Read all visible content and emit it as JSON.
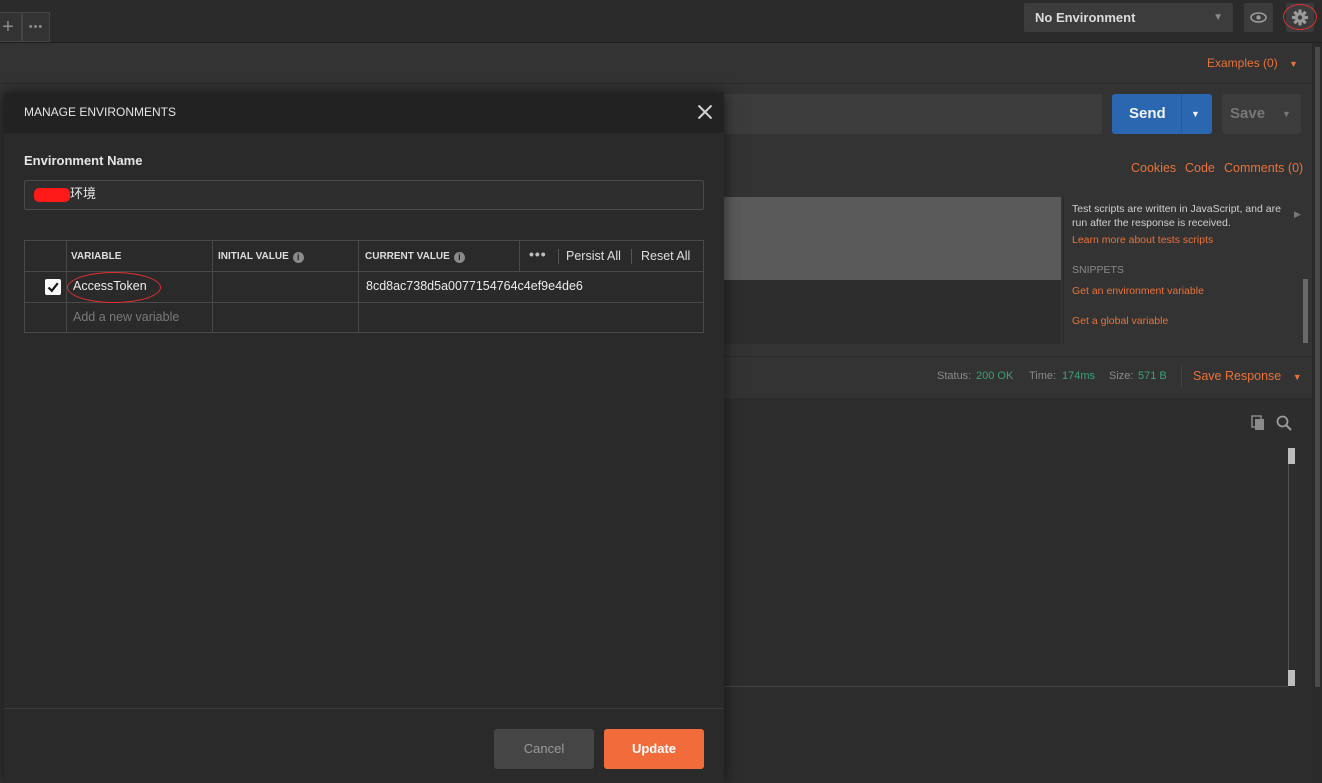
{
  "topbar": {
    "new_tab_symbol": "+",
    "more_symbol": "•••",
    "environment_select": "No Environment",
    "eye_icon": "eye-icon",
    "gear_icon": "gear-icon"
  },
  "request": {
    "examples_label": "Examples (0)",
    "send_label": "Send",
    "save_label": "Save",
    "cookies_label": "Cookies",
    "code_label": "Code",
    "comments_label": "Comments (0)"
  },
  "tests_sidebar": {
    "description": "Test scripts are written in JavaScript, and are run after the response is received.",
    "learn_more": "Learn more about tests scripts",
    "snippets_header": "SNIPPETS",
    "snippets": [
      "Get an environment variable",
      "Get a global variable"
    ]
  },
  "response": {
    "status_label": "Status:",
    "status_value": "200 OK",
    "time_label": "Time:",
    "time_value": "174ms",
    "size_label": "Size:",
    "size_value": "571 B",
    "save_response_label": "Save Response"
  },
  "modal": {
    "title": "MANAGE ENVIRONMENTS",
    "env_name_label": "Environment Name",
    "env_name_value": "环境",
    "columns": {
      "variable": "VARIABLE",
      "initial_value": "INITIAL VALUE",
      "current_value": "CURRENT VALUE"
    },
    "persist_all": "Persist All",
    "reset_all": "Reset All",
    "rows": [
      {
        "enabled": true,
        "variable": "AccessToken",
        "initial_value": "",
        "current_value": "8cd8ac738d5a0077154764c4ef9e4de6"
      }
    ],
    "new_variable_placeholder": "Add a new variable",
    "cancel_label": "Cancel",
    "update_label": "Update"
  },
  "colors": {
    "accent": "#f26b3a",
    "send_blue": "#2a67b0",
    "success_green": "#3aa374",
    "annotation_red": "#e03030"
  }
}
